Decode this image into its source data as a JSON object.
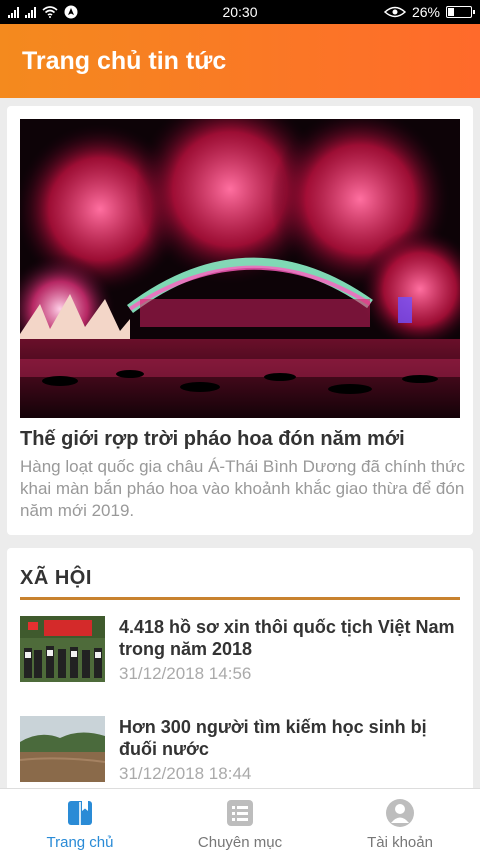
{
  "status_bar": {
    "time": "20:30",
    "battery": "26%",
    "battery_level": 0.26
  },
  "header": {
    "title": "Trang chủ tin tức"
  },
  "featured": {
    "title": "Thế giới rợp trời pháo hoa đón năm mới",
    "summary": "Hàng loạt quốc gia châu Á-Thái Bình Dương đã chính thức khai màn bắn pháo hoa vào khoảnh khắc giao thừa để đón năm mới 2019."
  },
  "section": {
    "title": "XÃ HỘI",
    "items": [
      {
        "title": "4.418 hồ sơ xin thôi quốc tịch Việt Nam trong năm 2018",
        "time": "31/12/2018 14:56"
      },
      {
        "title": "Hơn 300 người tìm kiếm học sinh bị đuối nước",
        "time": "31/12/2018 18:44"
      }
    ]
  },
  "nav": {
    "tabs": [
      {
        "label": "Trang chủ",
        "icon": "book-icon",
        "active": true
      },
      {
        "label": "Chuyên mục",
        "icon": "list-icon",
        "active": false
      },
      {
        "label": "Tài khoản",
        "icon": "user-icon",
        "active": false
      }
    ]
  },
  "colors": {
    "accent": "#f48a1e",
    "active_tab": "#2a8bd6",
    "section_rule": "#c8822e"
  }
}
